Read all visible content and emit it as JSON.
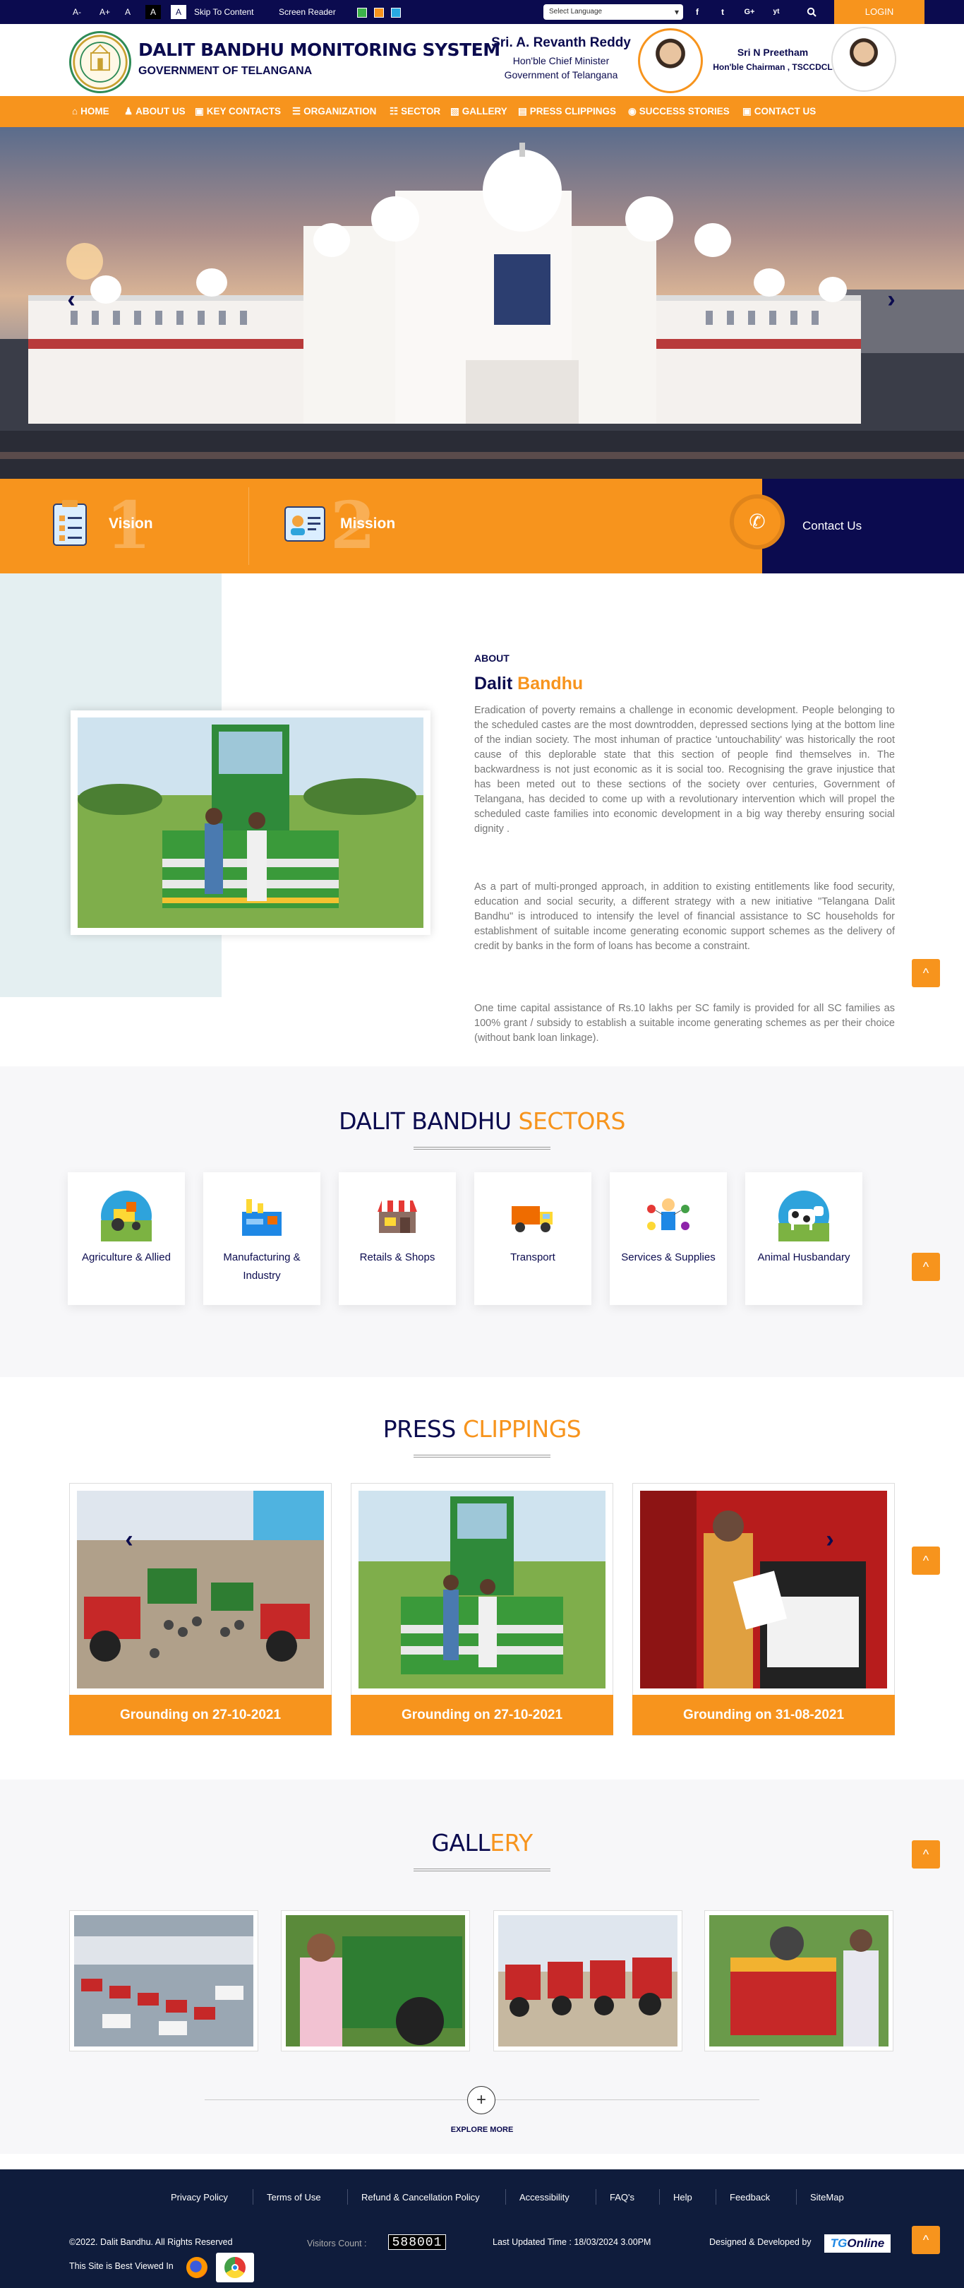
{
  "topbar": {
    "font_small": "A-",
    "font_large": "A+",
    "font_normal": "A",
    "contrast_dark": "A",
    "contrast_light": "A",
    "skip": "Skip To Content",
    "screen_reader": "Screen Reader",
    "language_placeholder": "Select Language",
    "social": [
      "f",
      "t",
      "G+",
      "yt"
    ],
    "search_icon": "search-icon",
    "login": "LOGIN",
    "theme_colors": [
      "#3cb34a",
      "#f7941d",
      "#29abe2"
    ]
  },
  "header": {
    "title": "DALIT BANDHU MONITORING SYSTEM",
    "subtitle": "GOVERNMENT OF TELANGANA",
    "cm_name": "Sri. A. Revanth Reddy",
    "cm_role": "Hon'ble Chief Minister",
    "cm_gov": "Government of Telangana",
    "chair_name": "Sri N Preetham",
    "chair_role": "Hon'ble Chairman , TSCCDCL"
  },
  "nav": {
    "items": [
      {
        "icon": "home-icon",
        "glyph": "⌂",
        "label": "HOME"
      },
      {
        "icon": "user-icon",
        "glyph": "♟",
        "label": "ABOUT US"
      },
      {
        "icon": "book-icon",
        "glyph": "▣",
        "label": "KEY CONTACTS"
      },
      {
        "icon": "list-icon",
        "glyph": "☰",
        "label": "ORGANIZATION"
      },
      {
        "icon": "table-icon",
        "glyph": "☷",
        "label": "SECTOR"
      },
      {
        "icon": "image-icon",
        "glyph": "▧",
        "label": "GALLERY"
      },
      {
        "icon": "newspaper-icon",
        "glyph": "▤",
        "label": "PRESS CLIPPINGS"
      },
      {
        "icon": "eye-icon",
        "glyph": "◉",
        "label": "SUCCESS STORIES"
      },
      {
        "icon": "book-icon",
        "glyph": "▣",
        "label": "CONTACT US"
      }
    ]
  },
  "hero": {
    "prev": "‹",
    "next": "›"
  },
  "strip": {
    "vision": "Vision",
    "vision_num": "1",
    "mission": "Mission",
    "mission_num": "2",
    "contact": "Contact Us",
    "contact_icon": "phone-icon"
  },
  "about": {
    "label": "ABOUT",
    "title_a": "Dalit",
    "title_b": "Bandhu",
    "p1": "Eradication of poverty remains a challenge in economic development. People belonging to the scheduled castes are the most downtrodden, depressed sections lying at the bottom line of the indian society. The most inhuman of practice 'untouchability' was historically the root cause of this deplorable state that this section of people find themselves in. The backwardness is not just economic as it is social too. Recognising the grave injustice that has been meted out to these sections of the society over centuries, Government of Telangana, has decided to come up with a revolutionary intervention which will propel the scheduled caste families into economic development in a big way thereby ensuring social dignity .",
    "p2": "As a part of multi-pronged approach, in addition to existing entitlements like food security, education and social security, a different strategy with a new initiative \"Telangana Dalit Bandhu\" is introduced to intensify the level of financial assistance to SC households for establishment of suitable income generating economic support schemes as the delivery of credit by banks in the form of loans has become a constraint.",
    "p3": "One time capital assistance of Rs.10 lakhs per SC family is provided for all SC families as 100% grant / subsidy to establish a suitable income generating schemes as per their choice (without bank loan linkage)."
  },
  "sectors": {
    "title_a": "DALIT BANDHU",
    "title_b": "SECTORS",
    "items": [
      {
        "icon": "tractor-icon",
        "label": "Agriculture & Allied",
        "color": "#2ea3dc"
      },
      {
        "icon": "factory-icon",
        "label": "Manufacturing & Industry",
        "color": "#ffffff"
      },
      {
        "icon": "shop-icon",
        "label": "Retails & Shops",
        "color": "#ffffff"
      },
      {
        "icon": "truck-icon",
        "label": "Transport",
        "color": "#ffffff"
      },
      {
        "icon": "services-icon",
        "label": "Services & Supplies",
        "color": "#ffffff"
      },
      {
        "icon": "cow-icon",
        "label": "Animal Husbandary",
        "color": "#2ea3dc"
      }
    ]
  },
  "press": {
    "title_a": "PRESS",
    "title_b": "CLIPPINGS",
    "prev": "‹",
    "next": "›",
    "items": [
      {
        "caption": "Grounding on 27-10-2021"
      },
      {
        "caption": "Grounding on 27-10-2021"
      },
      {
        "caption": "Grounding on 31-08-2021"
      }
    ]
  },
  "gallery": {
    "title_a": "GALL",
    "title_b": "ERY",
    "explore_icon": "plus-icon",
    "explore_glyph": "+",
    "explore": "EXPLORE MORE"
  },
  "scroll_top": "^",
  "footer": {
    "links": [
      "Privacy Policy",
      "Terms of Use",
      "Refund & Cancellation Policy",
      "Accessibility",
      "FAQ's",
      "Help",
      "Feedback",
      "SiteMap"
    ],
    "copyright": "©2022. Dalit Bandhu. All Rights Reserved",
    "visitors_label": "Visitors Count :",
    "visitors": "588001",
    "updated": "Last Updated Time : 18/03/2024 3.00PM",
    "designed": "Designed & Developed by",
    "designer_a": "TG",
    "designer_b": "Online",
    "best_viewed": "This Site is Best Viewed In"
  }
}
